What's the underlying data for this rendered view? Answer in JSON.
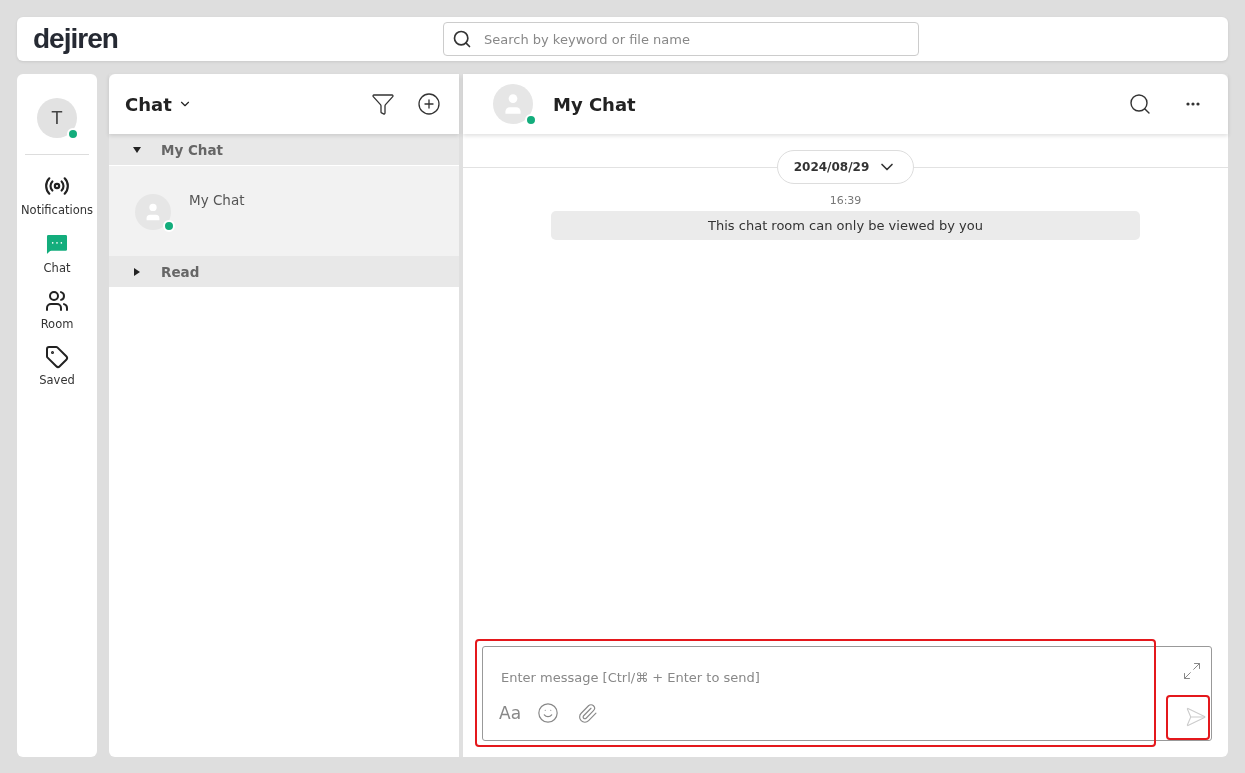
{
  "header": {
    "logo": "dejiren",
    "search": {
      "placeholder": "Search by keyword or file name"
    }
  },
  "user": {
    "initial": "T",
    "online": true
  },
  "nav": [
    {
      "label": "Notifications",
      "kind": "notifications",
      "selected": false
    },
    {
      "label": "Chat",
      "kind": "chat",
      "selected": true
    },
    {
      "label": "Room",
      "kind": "room",
      "selected": false
    },
    {
      "label": "Saved",
      "kind": "saved",
      "selected": false
    }
  ],
  "list": {
    "title": "Chat",
    "groups": [
      {
        "label": "My Chat",
        "expanded": true,
        "items": [
          {
            "name": "My Chat",
            "online": true,
            "selected": true
          }
        ]
      },
      {
        "label": "Read",
        "expanded": false
      }
    ]
  },
  "conversation": {
    "title": "My Chat",
    "online": true,
    "date": "2024/08/29",
    "messages": [
      {
        "time": "16:39",
        "text": "This chat room can only be viewed by you"
      }
    ],
    "composer": {
      "placeholder": "Enter message [Ctrl/⌘ + Enter to send]",
      "format": "Aa",
      "highlighted": true,
      "send_highlighted": true
    }
  }
}
